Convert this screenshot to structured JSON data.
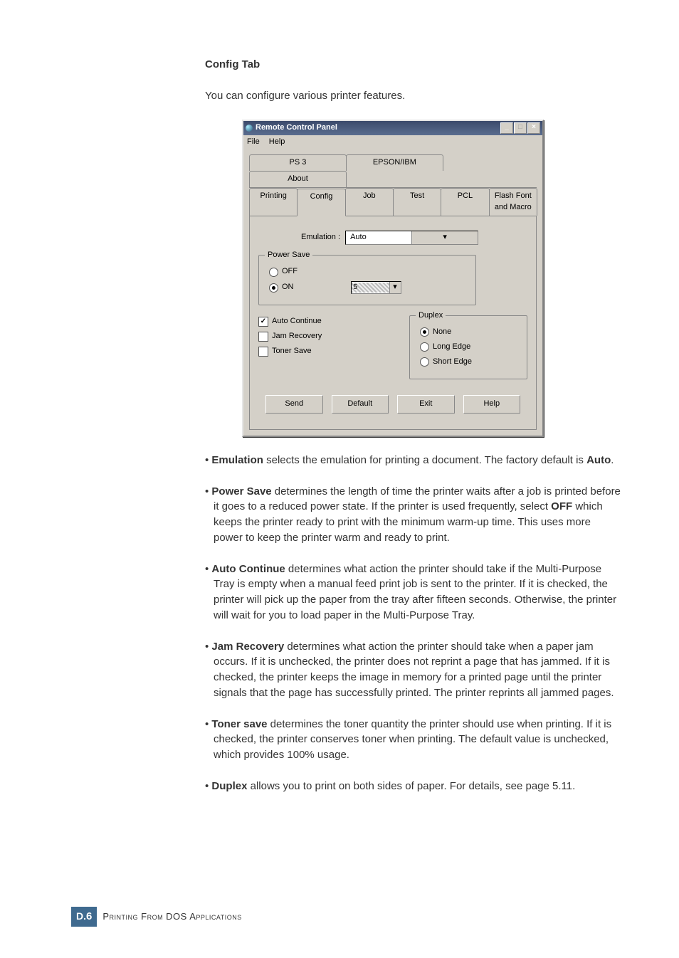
{
  "heading": "Config Tab",
  "intro": "You can configure various printer features.",
  "dialog": {
    "title": "Remote Control Panel",
    "menu": {
      "file": "File",
      "help": "Help"
    },
    "tabs_row1": [
      "PS 3",
      "EPSON/IBM",
      "About"
    ],
    "tabs_row2": [
      "Printing",
      "Config",
      "Job",
      "Test",
      "PCL",
      "Flash Font and Macro"
    ],
    "emulation_label": "Emulation :",
    "emulation_value": "Auto",
    "powersave": {
      "legend": "Power Save",
      "off": "OFF",
      "on": "ON",
      "on_val": "5"
    },
    "auto_continue": "Auto Continue",
    "jam_recovery": "Jam Recovery",
    "toner_save": "Toner Save",
    "duplex": {
      "legend": "Duplex",
      "none": "None",
      "long": "Long Edge",
      "short": "Short Edge"
    },
    "buttons": {
      "send": "Send",
      "default": "Default",
      "exit": "Exit",
      "help": "Help"
    }
  },
  "bullets": {
    "emulation_b": "Emulation",
    "emulation_t1": " selects the emulation for printing a document. The factory default is ",
    "emulation_auto": "Auto",
    "powersave_b": "Power Save",
    "powersave_t1": " determines the length of time the printer waits after a job is printed before it goes to a reduced power state. If the printer is used frequently, select ",
    "powersave_off": "OFF",
    "powersave_t2": " which keeps the printer ready to print with the minimum warm-up time. This uses more power to keep the printer warm and ready to print.",
    "autocont_b": "Auto Continue",
    "autocont_t": " determines what action the printer should take if the Multi-Purpose Tray is empty when a manual feed print job is sent to the printer. If it is checked, the printer will pick up the paper from the tray after fifteen seconds. Otherwise, the printer will wait for you to load paper in the Multi-Purpose Tray.",
    "jam_b": "Jam Recovery",
    "jam_t": " determines what action the printer should take when a paper jam occurs. If it is unchecked, the printer does not reprint a page that has jammed. If it is checked, the printer keeps the image in memory for a printed page until the printer signals that the page has successfully printed. The printer reprints all jammed pages.",
    "toner_b": "Toner save",
    "toner_t": " determines the toner quantity the printer should use when printing. If it is checked, the printer conserves toner when printing. The default value is unchecked, which provides 100% usage.",
    "duplex_b": "Duplex",
    "duplex_t": " allows you to print on both sides of paper. For details, see page 5.11."
  },
  "footer": {
    "chapter": "D.",
    "page": "6",
    "text": "Printing From DOS Applications"
  }
}
